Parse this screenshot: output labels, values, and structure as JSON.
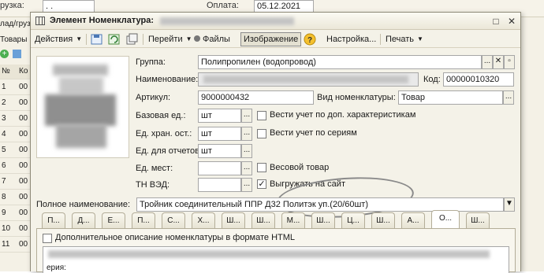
{
  "background": {
    "field1_label": "рузка:",
    "field1_value": ". .",
    "field2_label": "Оплата:",
    "field2_value": "05.12.2021",
    "left_labels": [
      "лад/груз",
      "Товары"
    ],
    "column_header": "№",
    "column_header2": "Ко",
    "row_numbers": [
      "1",
      "2",
      "3",
      "4",
      "5",
      "6",
      "7",
      "8",
      "9",
      "10",
      "11"
    ],
    "row_codes": [
      "00",
      "00",
      "00",
      "00",
      "00",
      "00",
      "00",
      "00",
      "00",
      "00",
      "00"
    ]
  },
  "dialog": {
    "title": "Элемент Номенклатура:",
    "window_buttons": {
      "maximize": "□",
      "close": "✕"
    }
  },
  "toolbar": {
    "actions": "Действия",
    "go": "Перейти",
    "files": "Файлы",
    "image": "Изображение",
    "help": "?",
    "settings": "Настройка...",
    "print": "Печать"
  },
  "form": {
    "group_label": "Группа:",
    "group_value": "Полипропилен (водопровод)",
    "name_label": "Наименование:",
    "code_label": "Код:",
    "code_value": "00000010320",
    "article_label": "Артикул:",
    "article_value": "9000000432",
    "kind_label": "Вид номенклатуры:",
    "kind_value": "Товар",
    "base_unit_label": "Базовая ед.:",
    "base_unit_value": "шт",
    "storage_unit_label": "Ед. хран. ост.:",
    "storage_unit_value": "шт",
    "report_unit_label": "Ед. для отчетов:",
    "report_unit_value": "шт",
    "places_unit_label": "Ед. мест:",
    "places_unit_value": "",
    "tnved_label": "ТН ВЭД:",
    "tnved_value": "",
    "chk_characteristics": "Вести учет по доп. характеристикам",
    "chk_series": "Вести учет по сериям",
    "chk_weight": "Весовой товар",
    "chk_upload": "Выгружать на сайт",
    "chk_upload_mark": "✓",
    "full_name_label": "Полное наименование:",
    "full_name_value": "Тройник соединительный ППР Д32 Политэк уп.(20/60шт)",
    "more_btn": "...",
    "clear_btn": "✕",
    "open_btn": "▫",
    "select_arrow": "▼"
  },
  "tabs": [
    "П...",
    "Д...",
    "Е...",
    "П...",
    "С...",
    "Х...",
    "Ш...",
    "Ш...",
    "М...",
    "Ш...",
    "Ц...",
    "Ш...",
    "А...",
    "О...",
    "Ш..."
  ],
  "active_tab_index": 13,
  "tab_panel": {
    "html_checkbox": "Дополнительное описание номенклатуры в формате HTML",
    "text_fragment": "ерия:"
  },
  "colors": {
    "dialog_bg": "#f4f2e8",
    "field_border": "#a6a6a6",
    "annotation_circle": "#8a8a8a"
  }
}
